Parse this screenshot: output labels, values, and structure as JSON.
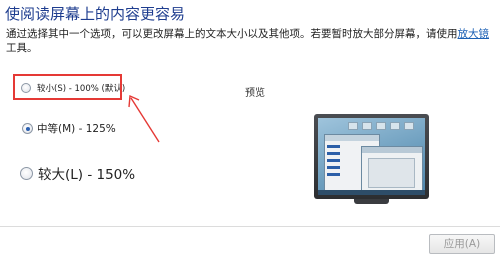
{
  "page": {
    "title": "使阅读屏幕上的内容更容易",
    "description_text": "通过选择其中一个选项，可以更改屏幕上的文本大小以及其他项。若要暂时放大部分屏幕，请使用",
    "description_link": "放大镜",
    "description_suffix": "工具。"
  },
  "options": [
    {
      "label": "较小(S) - 100% (默认)",
      "checked": false
    },
    {
      "label": "中等(M) - 125%",
      "checked": true
    },
    {
      "label": "较大(L) - 150%",
      "checked": false
    }
  ],
  "preview": {
    "label": "预览",
    "icon": "monitor-preview-image"
  },
  "footer": {
    "apply_label": "应用(A)",
    "apply_enabled": false
  },
  "annotation": {
    "highlight_color": "#e53935"
  }
}
